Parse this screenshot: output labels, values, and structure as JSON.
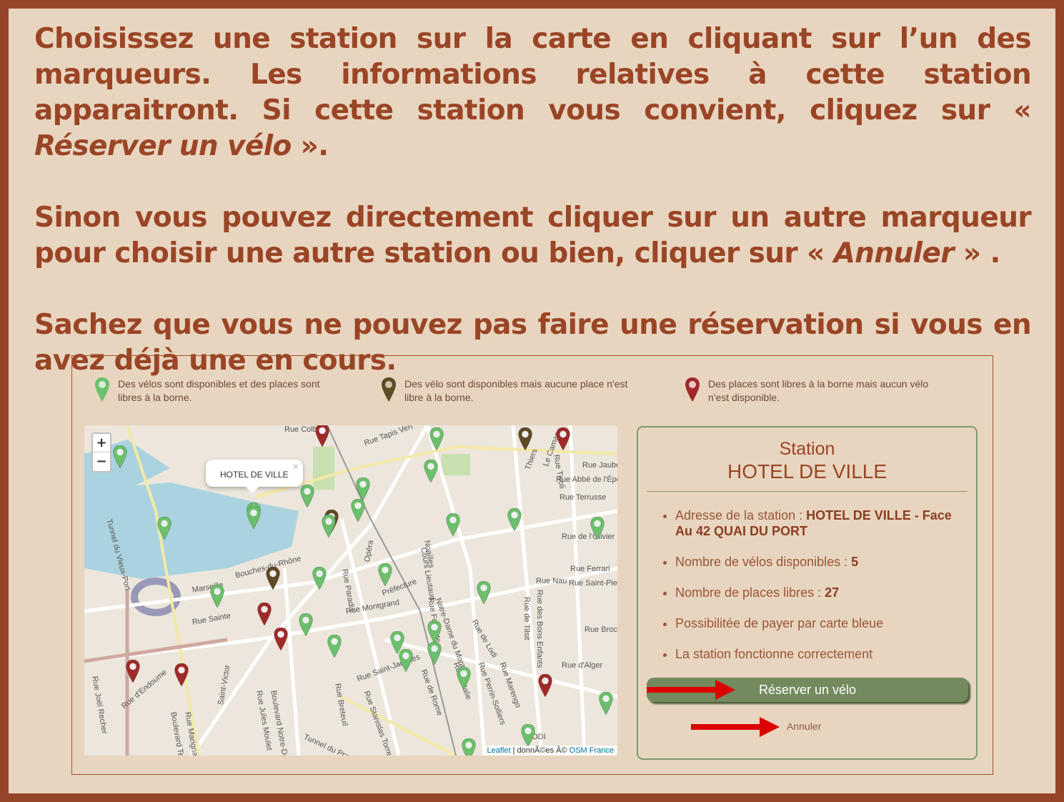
{
  "instructions": {
    "p1_a": "Choisissez une station sur la carte en cliquant sur l’un des marqueurs. Les informations relatives à cette station apparaitront. Si cette station vous convient, cliquez sur « ",
    "p1_em": "Réserver un vélo",
    "p1_b": " ».",
    "p2_a": "Sinon vous pouvez directement cliquer sur un autre marqueur pour choisir une autre station ou bien, cliquer sur « ",
    "p2_em": "Annuler",
    "p2_b": " » .",
    "p3": "Sachez que vous ne pouvez pas faire une réservation si vous en avez déjà une en cours."
  },
  "legend": [
    {
      "text": "Des vélos sont disponibles et des places sont libres à la borne.",
      "color": "#6cbf6c"
    },
    {
      "text": "Des vélo sont disponibles mais aucune place n'est libre à la borne.",
      "color": "#5e4a26"
    },
    {
      "text": "Des places sont libres à la borne mais aucun vélo n'est disponible.",
      "color": "#a02a2a"
    }
  ],
  "map": {
    "zoom_in": "+",
    "zoom_out": "−",
    "popup_title": "HOTEL DE VILLE",
    "popup_close": "×",
    "attribution_leaflet": "Leaflet",
    "attribution_rest": " | donnÃ©es Â© ",
    "attribution_osm": "OSM France",
    "streets": [
      "Rue Colbert",
      "Rue Tapis Vert",
      "Rue Jaubert",
      "Rue Abbé de l'Épée",
      "Rue Terrusse",
      "Rue de l'Olivier",
      "Rue Ferrari",
      "Rue Saint-Pierre",
      "Rue Nau",
      "Rue Brochier",
      "Rue d'Alger",
      "Thiers",
      "Le Camas",
      "Rue Tivoli",
      "Cours Lieutaud",
      "Noailles",
      "Opéra",
      "Rue Paradis",
      "Préfecture",
      "Rue Montgrand",
      "Rue Fongate",
      "Notre-Dame du Mont",
      "Rue de Lodi",
      "Rue de Tilsit",
      "Rue des Bons Enfants",
      "Rue Perrin-Solliers",
      "Rue Marengo",
      "Rue d'Italie",
      "Rue de Rome",
      "Rue Saint-Jacques",
      "Rue Stanislas Torrents",
      "Rue Breteuil",
      "Tunnel du Prado",
      "Boulevard Notre-Dame",
      "Rue Jules Moulet",
      "Saint-Victor",
      "Rue Marignan",
      "Boulevard Tellène",
      "Rue d'Endoume",
      "Rue Joël Recher",
      "Rue Sainte",
      "Bouches-du-Rhône",
      "Marseille",
      "Tunnel du Vieux-Port",
      "LODI"
    ]
  },
  "station": {
    "heading": "Station",
    "name": "HOTEL DE VILLE",
    "address_label": "Adresse de la station : ",
    "address_value": "HOTEL DE VILLE - Face Au 42 QUAI DU PORT",
    "bikes_label": "Nombre de vélos disponibles : ",
    "bikes_value": "5",
    "places_label": "Nombre de places libres : ",
    "places_value": "27",
    "card": "Possibilitée de payer par carte bleue",
    "status": "La station fonctionne correctement",
    "reserve_button": "Réserver un vélo",
    "cancel_link": "Annuler"
  },
  "colors": {
    "brand": "#9a4526",
    "accent": "#738a5e",
    "arrow": "#dd0000"
  }
}
